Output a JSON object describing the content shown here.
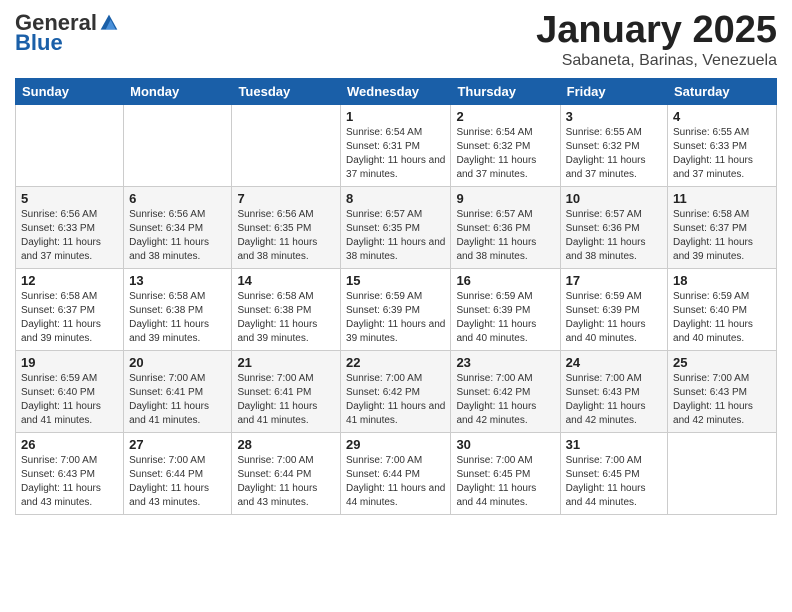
{
  "header": {
    "logo_general": "General",
    "logo_blue": "Blue",
    "month_title": "January 2025",
    "location": "Sabaneta, Barinas, Venezuela"
  },
  "days_of_week": [
    "Sunday",
    "Monday",
    "Tuesday",
    "Wednesday",
    "Thursday",
    "Friday",
    "Saturday"
  ],
  "weeks": [
    {
      "days": [
        {
          "num": "",
          "info": ""
        },
        {
          "num": "",
          "info": ""
        },
        {
          "num": "",
          "info": ""
        },
        {
          "num": "1",
          "info": "Sunrise: 6:54 AM\nSunset: 6:31 PM\nDaylight: 11 hours and 37 minutes."
        },
        {
          "num": "2",
          "info": "Sunrise: 6:54 AM\nSunset: 6:32 PM\nDaylight: 11 hours and 37 minutes."
        },
        {
          "num": "3",
          "info": "Sunrise: 6:55 AM\nSunset: 6:32 PM\nDaylight: 11 hours and 37 minutes."
        },
        {
          "num": "4",
          "info": "Sunrise: 6:55 AM\nSunset: 6:33 PM\nDaylight: 11 hours and 37 minutes."
        }
      ]
    },
    {
      "days": [
        {
          "num": "5",
          "info": "Sunrise: 6:56 AM\nSunset: 6:33 PM\nDaylight: 11 hours and 37 minutes."
        },
        {
          "num": "6",
          "info": "Sunrise: 6:56 AM\nSunset: 6:34 PM\nDaylight: 11 hours and 38 minutes."
        },
        {
          "num": "7",
          "info": "Sunrise: 6:56 AM\nSunset: 6:35 PM\nDaylight: 11 hours and 38 minutes."
        },
        {
          "num": "8",
          "info": "Sunrise: 6:57 AM\nSunset: 6:35 PM\nDaylight: 11 hours and 38 minutes."
        },
        {
          "num": "9",
          "info": "Sunrise: 6:57 AM\nSunset: 6:36 PM\nDaylight: 11 hours and 38 minutes."
        },
        {
          "num": "10",
          "info": "Sunrise: 6:57 AM\nSunset: 6:36 PM\nDaylight: 11 hours and 38 minutes."
        },
        {
          "num": "11",
          "info": "Sunrise: 6:58 AM\nSunset: 6:37 PM\nDaylight: 11 hours and 39 minutes."
        }
      ]
    },
    {
      "days": [
        {
          "num": "12",
          "info": "Sunrise: 6:58 AM\nSunset: 6:37 PM\nDaylight: 11 hours and 39 minutes."
        },
        {
          "num": "13",
          "info": "Sunrise: 6:58 AM\nSunset: 6:38 PM\nDaylight: 11 hours and 39 minutes."
        },
        {
          "num": "14",
          "info": "Sunrise: 6:58 AM\nSunset: 6:38 PM\nDaylight: 11 hours and 39 minutes."
        },
        {
          "num": "15",
          "info": "Sunrise: 6:59 AM\nSunset: 6:39 PM\nDaylight: 11 hours and 39 minutes."
        },
        {
          "num": "16",
          "info": "Sunrise: 6:59 AM\nSunset: 6:39 PM\nDaylight: 11 hours and 40 minutes."
        },
        {
          "num": "17",
          "info": "Sunrise: 6:59 AM\nSunset: 6:39 PM\nDaylight: 11 hours and 40 minutes."
        },
        {
          "num": "18",
          "info": "Sunrise: 6:59 AM\nSunset: 6:40 PM\nDaylight: 11 hours and 40 minutes."
        }
      ]
    },
    {
      "days": [
        {
          "num": "19",
          "info": "Sunrise: 6:59 AM\nSunset: 6:40 PM\nDaylight: 11 hours and 41 minutes."
        },
        {
          "num": "20",
          "info": "Sunrise: 7:00 AM\nSunset: 6:41 PM\nDaylight: 11 hours and 41 minutes."
        },
        {
          "num": "21",
          "info": "Sunrise: 7:00 AM\nSunset: 6:41 PM\nDaylight: 11 hours and 41 minutes."
        },
        {
          "num": "22",
          "info": "Sunrise: 7:00 AM\nSunset: 6:42 PM\nDaylight: 11 hours and 41 minutes."
        },
        {
          "num": "23",
          "info": "Sunrise: 7:00 AM\nSunset: 6:42 PM\nDaylight: 11 hours and 42 minutes."
        },
        {
          "num": "24",
          "info": "Sunrise: 7:00 AM\nSunset: 6:43 PM\nDaylight: 11 hours and 42 minutes."
        },
        {
          "num": "25",
          "info": "Sunrise: 7:00 AM\nSunset: 6:43 PM\nDaylight: 11 hours and 42 minutes."
        }
      ]
    },
    {
      "days": [
        {
          "num": "26",
          "info": "Sunrise: 7:00 AM\nSunset: 6:43 PM\nDaylight: 11 hours and 43 minutes."
        },
        {
          "num": "27",
          "info": "Sunrise: 7:00 AM\nSunset: 6:44 PM\nDaylight: 11 hours and 43 minutes."
        },
        {
          "num": "28",
          "info": "Sunrise: 7:00 AM\nSunset: 6:44 PM\nDaylight: 11 hours and 43 minutes."
        },
        {
          "num": "29",
          "info": "Sunrise: 7:00 AM\nSunset: 6:44 PM\nDaylight: 11 hours and 44 minutes."
        },
        {
          "num": "30",
          "info": "Sunrise: 7:00 AM\nSunset: 6:45 PM\nDaylight: 11 hours and 44 minutes."
        },
        {
          "num": "31",
          "info": "Sunrise: 7:00 AM\nSunset: 6:45 PM\nDaylight: 11 hours and 44 minutes."
        },
        {
          "num": "",
          "info": ""
        }
      ]
    }
  ]
}
